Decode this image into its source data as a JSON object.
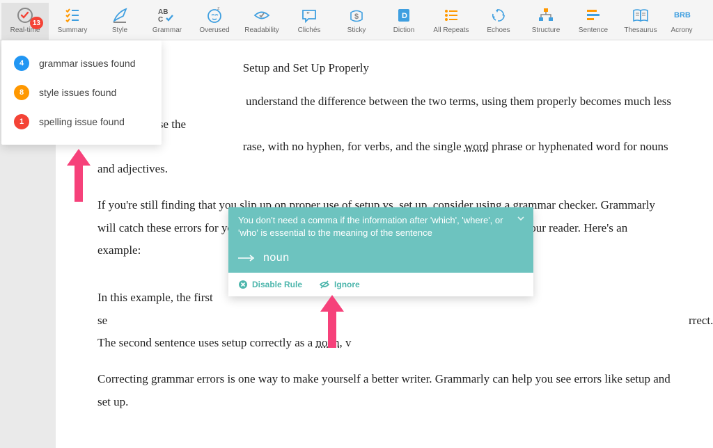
{
  "toolbar": {
    "items": [
      {
        "label": "Real-time",
        "badge": "13"
      },
      {
        "label": "Summary"
      },
      {
        "label": "Style"
      },
      {
        "label": "Grammar"
      },
      {
        "label": "Overused"
      },
      {
        "label": "Readability"
      },
      {
        "label": "Clichés"
      },
      {
        "label": "Sticky"
      },
      {
        "label": "Diction"
      },
      {
        "label": "All Repeats"
      },
      {
        "label": "Echoes"
      },
      {
        "label": "Structure"
      },
      {
        "label": "Sentence"
      },
      {
        "label": "Thesaurus"
      },
      {
        "label": "Acrony"
      }
    ]
  },
  "dropdown": {
    "items": [
      {
        "count": "4",
        "label": "grammar issues found"
      },
      {
        "count": "8",
        "label": "style issues found"
      },
      {
        "count": "1",
        "label": "spelling issue found"
      }
    ]
  },
  "document": {
    "heading_partial": "Setup and Set Up Properly",
    "p1_a": " understand the difference between the two terms, using them properly becomes much less confusing. Use the ",
    "p1_b": "rase, with no hyphen, for verbs, and the single ",
    "p1_word": "word",
    "p1_c": " phrase or hyphenated word for nouns and adjectives.",
    "p2": "If you're still finding that you slip up on proper use of setup vs. set up, consider using a grammar checker. Grammarly will catch these errors for you, so you can correct them before you submit your writing to your reader. Here's an example:",
    "p3_a": "In this example, the first se",
    "p3_b": "rrect. The second sentence uses setup correctly as a ",
    "p3_noun": "noun,",
    "p3_c": " v",
    "p4": "Correcting grammar errors is one way to make yourself a better writer. Grammarly can help you see errors like setup and set up."
  },
  "tooltip": {
    "message": "You don't need a comma if the information after 'which', 'where', or 'who' is essential to the meaning of the sentence",
    "suggestion": "noun",
    "actions": {
      "disable": "Disable Rule",
      "ignore": "Ignore"
    }
  }
}
